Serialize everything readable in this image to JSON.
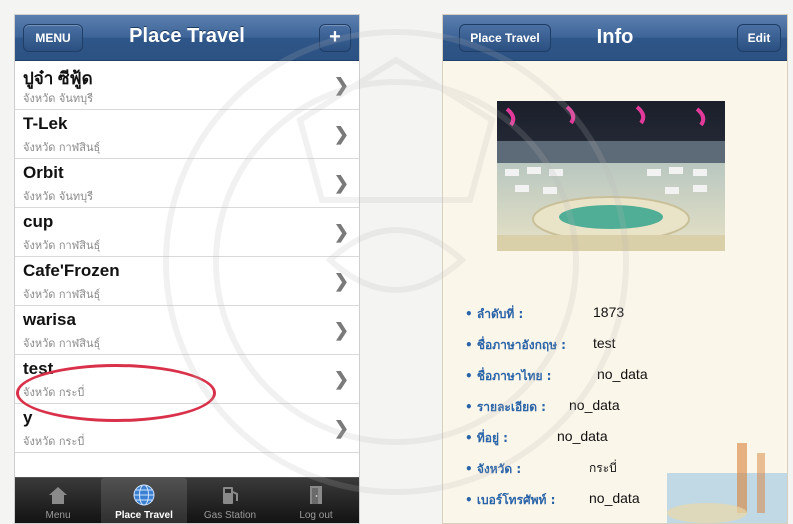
{
  "left": {
    "menu_label": "MENU",
    "title": "Place Travel",
    "plus_label": "+",
    "rows": [
      {
        "title": "ปูจ๋า ซีฟู้ด",
        "subtitle": "จังหวัด จันทบุรี"
      },
      {
        "title": "T-Lek",
        "subtitle": "จังหวัด กาฬสินธุ์"
      },
      {
        "title": "Orbit",
        "subtitle": "จังหวัด จันทบุรี"
      },
      {
        "title": "cup",
        "subtitle": "จังหวัด กาฬสินธุ์"
      },
      {
        "title": "Cafe'Frozen",
        "subtitle": "จังหวัด กาฬสินธุ์"
      },
      {
        "title": "warisa",
        "subtitle": "จังหวัด กาฬสินธุ์"
      },
      {
        "title": "test",
        "subtitle": "จังหวัด กระบี่"
      },
      {
        "title": "y",
        "subtitle": "จังหวัด กระบี่"
      }
    ],
    "tabs": [
      {
        "label": "Menu",
        "icon": "home-icon"
      },
      {
        "label": "Place Travel",
        "icon": "globe-icon"
      },
      {
        "label": "Gas Station",
        "icon": "fuel-icon"
      },
      {
        "label": "Log out",
        "icon": "logout-icon"
      }
    ]
  },
  "right": {
    "back_label": "Place Travel",
    "title": "Info",
    "edit_label": "Edit",
    "details": [
      {
        "label": "• ลำดับที่ :",
        "value": "1873"
      },
      {
        "label": "• ชื่อภาษาอังกฤษ :",
        "value": "test"
      },
      {
        "label": "• ชื่อภาษาไทย :",
        "value": "no_data"
      },
      {
        "label": "• รายละเอียด :",
        "value": "no_data"
      },
      {
        "label": "• ที่อยู่ :",
        "value": "no_data"
      },
      {
        "label": "• จังหวัด :",
        "value": "กระบี่"
      },
      {
        "label": "• เบอร์โทรศัพท์ :",
        "value": "no_data"
      }
    ]
  },
  "colors": {
    "navbar": "#3d6498",
    "highlight_circle": "#d9314a",
    "label_blue": "#2a64a8"
  }
}
